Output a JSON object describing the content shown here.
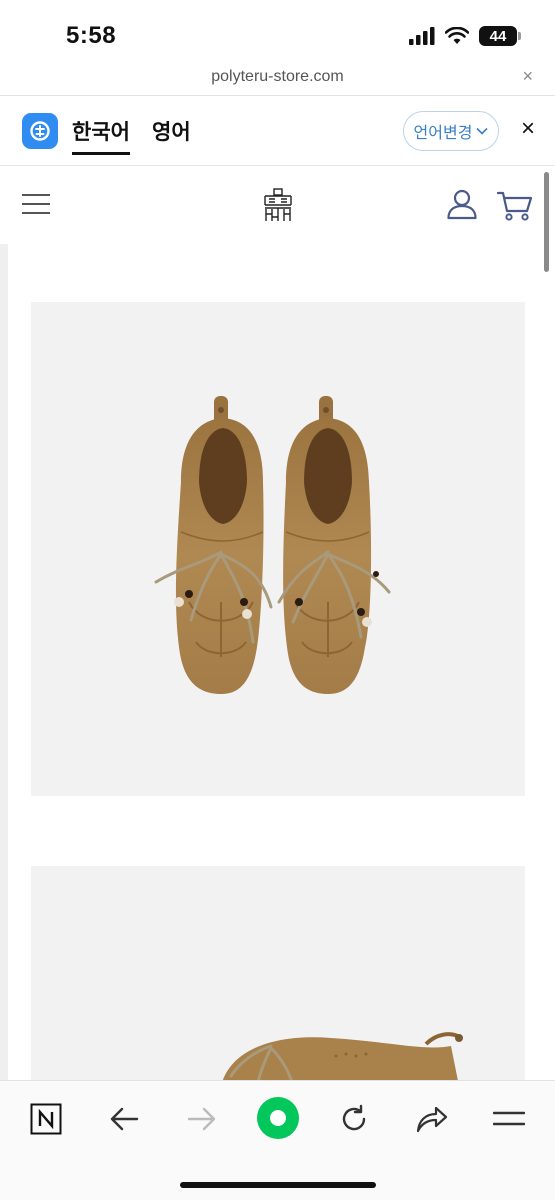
{
  "status": {
    "time": "5:58",
    "battery": "44"
  },
  "browser": {
    "url": "polyteru-store.com",
    "close_label": "×"
  },
  "translate": {
    "tabs": [
      {
        "label": "한국어",
        "active": true
      },
      {
        "label": "영어",
        "active": false
      }
    ],
    "change_language_label": "언어변경",
    "close_label": "×"
  },
  "header": {
    "icons": [
      "hamburger-menu-icon",
      "site-logo",
      "user-icon",
      "cart-icon"
    ]
  },
  "product_images": [
    {
      "subject": "suede moccasin shoes pair, top view"
    },
    {
      "subject": "suede moccasin shoes pair, side view"
    }
  ],
  "toolbar": {
    "icons": [
      "naver-icon",
      "back-icon",
      "forward-icon",
      "green-home-icon",
      "reload-icon",
      "share-icon",
      "menu-icon"
    ]
  },
  "colors": {
    "accent_blue": "#2f8cf0",
    "green": "#03c75a",
    "suede": "#a8814b"
  }
}
